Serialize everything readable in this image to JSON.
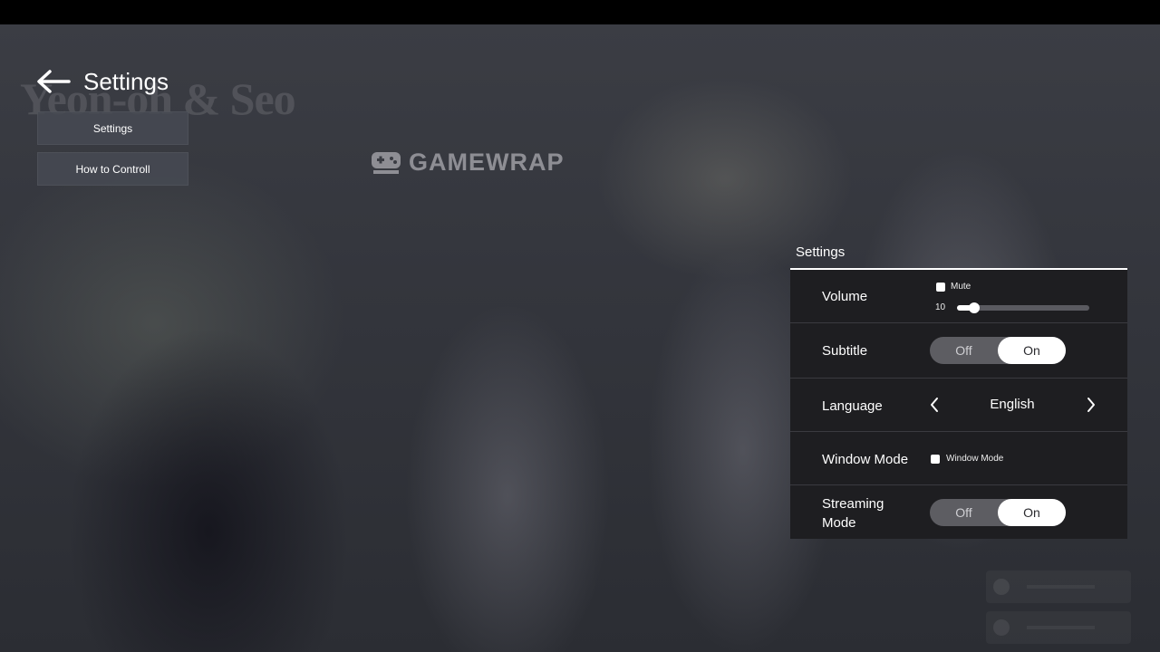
{
  "header": {
    "title": "Settings"
  },
  "nav": {
    "items": [
      {
        "label": "Settings"
      },
      {
        "label": "How to Controll"
      }
    ]
  },
  "watermark": {
    "text": "GAMEWRAP"
  },
  "panel": {
    "title": "Settings",
    "volume": {
      "label": "Volume",
      "mute_label": "Mute",
      "mute_checked": false,
      "value": "10",
      "level_fraction": 0.13
    },
    "subtitle": {
      "label": "Subtitle",
      "off_label": "Off",
      "on_label": "On",
      "selected": "On"
    },
    "language": {
      "label": "Language",
      "value": "English"
    },
    "window_mode": {
      "label": "Window Mode",
      "checkbox_label": "Window Mode",
      "checked": false
    },
    "streaming_mode": {
      "label_line1": "Streaming",
      "label_line2": "Mode",
      "off_label": "Off",
      "on_label": "On",
      "selected": "On"
    }
  },
  "colors": {
    "panel_bg": "#1e1e21",
    "toggle_bg": "#5d5d62",
    "toggle_active": "#ffffff",
    "nav_button_bg": "#464952"
  },
  "icons": {
    "back": "arrow-left-icon",
    "language_prev": "chevron-left-icon",
    "language_next": "chevron-right-icon",
    "watermark_logo": "gamepad-icon"
  }
}
